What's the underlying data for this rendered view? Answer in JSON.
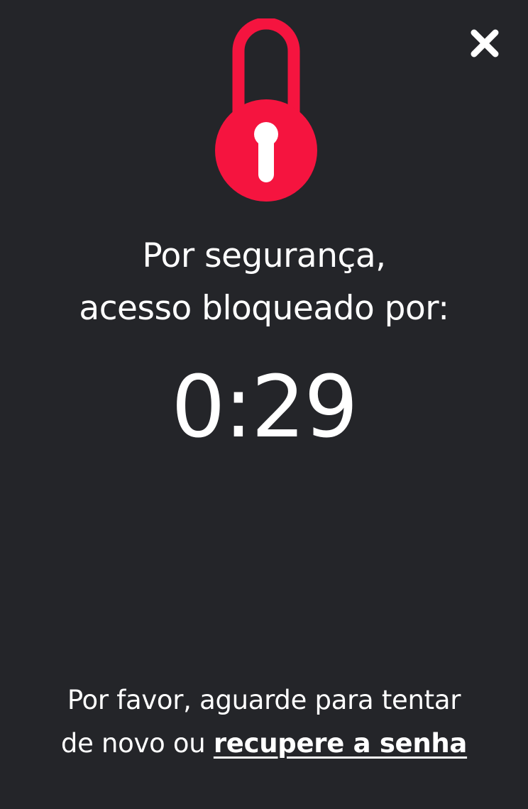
{
  "colors": {
    "background": "#242529",
    "accent": "#f5143f",
    "text": "#ffffff"
  },
  "header": {
    "close_icon": "close-icon"
  },
  "lock": {
    "icon": "padlock-icon",
    "state": "locked"
  },
  "message": {
    "line1": "Por segurança,",
    "line2": "acesso bloqueado por:"
  },
  "timer": {
    "value": "0:29"
  },
  "footer": {
    "line1": "Por favor, aguarde para tentar",
    "line2_prefix": "de novo ou ",
    "link_label": "recupere a senha"
  }
}
